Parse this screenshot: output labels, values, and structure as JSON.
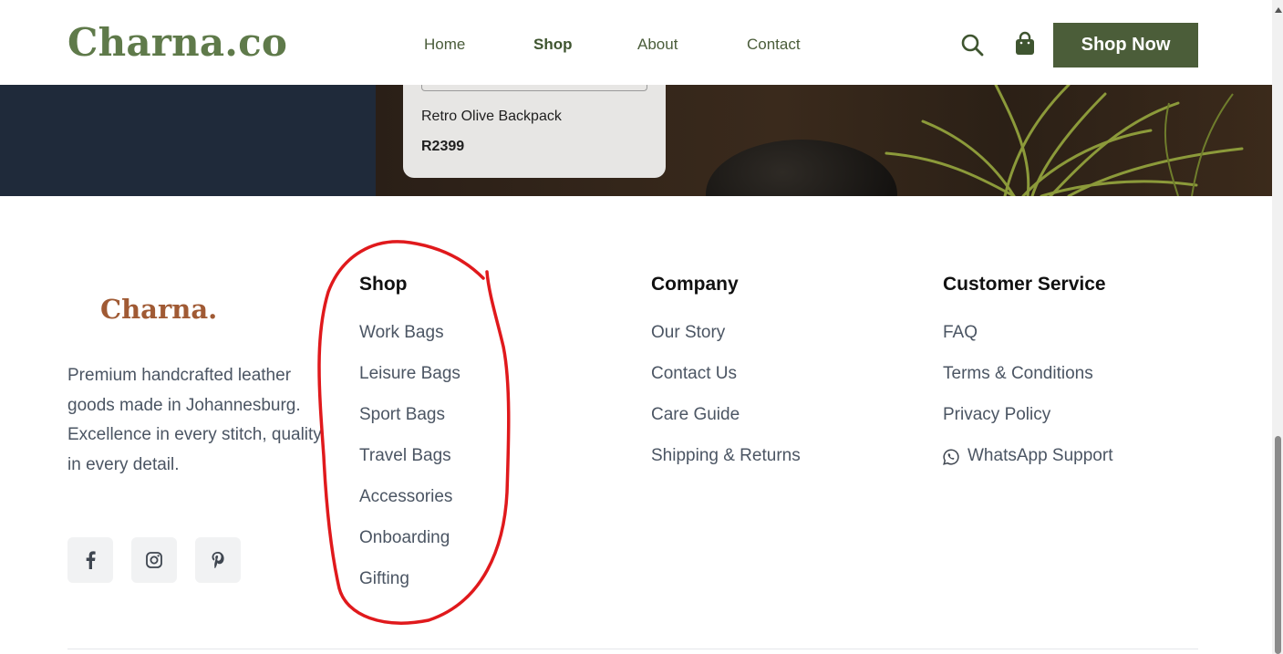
{
  "header": {
    "logo": "Charna.co",
    "nav": [
      "Home",
      "Shop",
      "About",
      "Contact"
    ],
    "search_icon": "search-icon",
    "bag_icon": "shopping-bag-icon",
    "shop_now_label": "Shop Now"
  },
  "hero": {
    "product": {
      "name": "Retro Olive Backpack",
      "price": "R2399"
    }
  },
  "footer": {
    "logo": "Charna.",
    "description": "Premium handcrafted leather goods made in Johannesburg. Excellence in every stitch, quality in every detail.",
    "socials": [
      "facebook-icon",
      "instagram-icon",
      "pinterest-icon"
    ],
    "columns": [
      {
        "title": "Shop",
        "links": [
          "Work Bags",
          "Leisure Bags",
          "Sport Bags",
          "Travel Bags",
          "Accessories",
          "Onboarding",
          "Gifting"
        ]
      },
      {
        "title": "Company",
        "links": [
          "Our Story",
          "Contact Us",
          "Care Guide",
          "Shipping & Returns"
        ]
      },
      {
        "title": "Customer Service",
        "links": [
          "FAQ",
          "Terms & Conditions",
          "Privacy Policy",
          "WhatsApp Support"
        ]
      }
    ]
  },
  "colors": {
    "brand_green": "#5f7a4a",
    "button_green": "#4b5d39",
    "footer_logo": "#a05a34",
    "annotation_red": "#e0191c",
    "hero_navy": "#1f2a3a"
  }
}
